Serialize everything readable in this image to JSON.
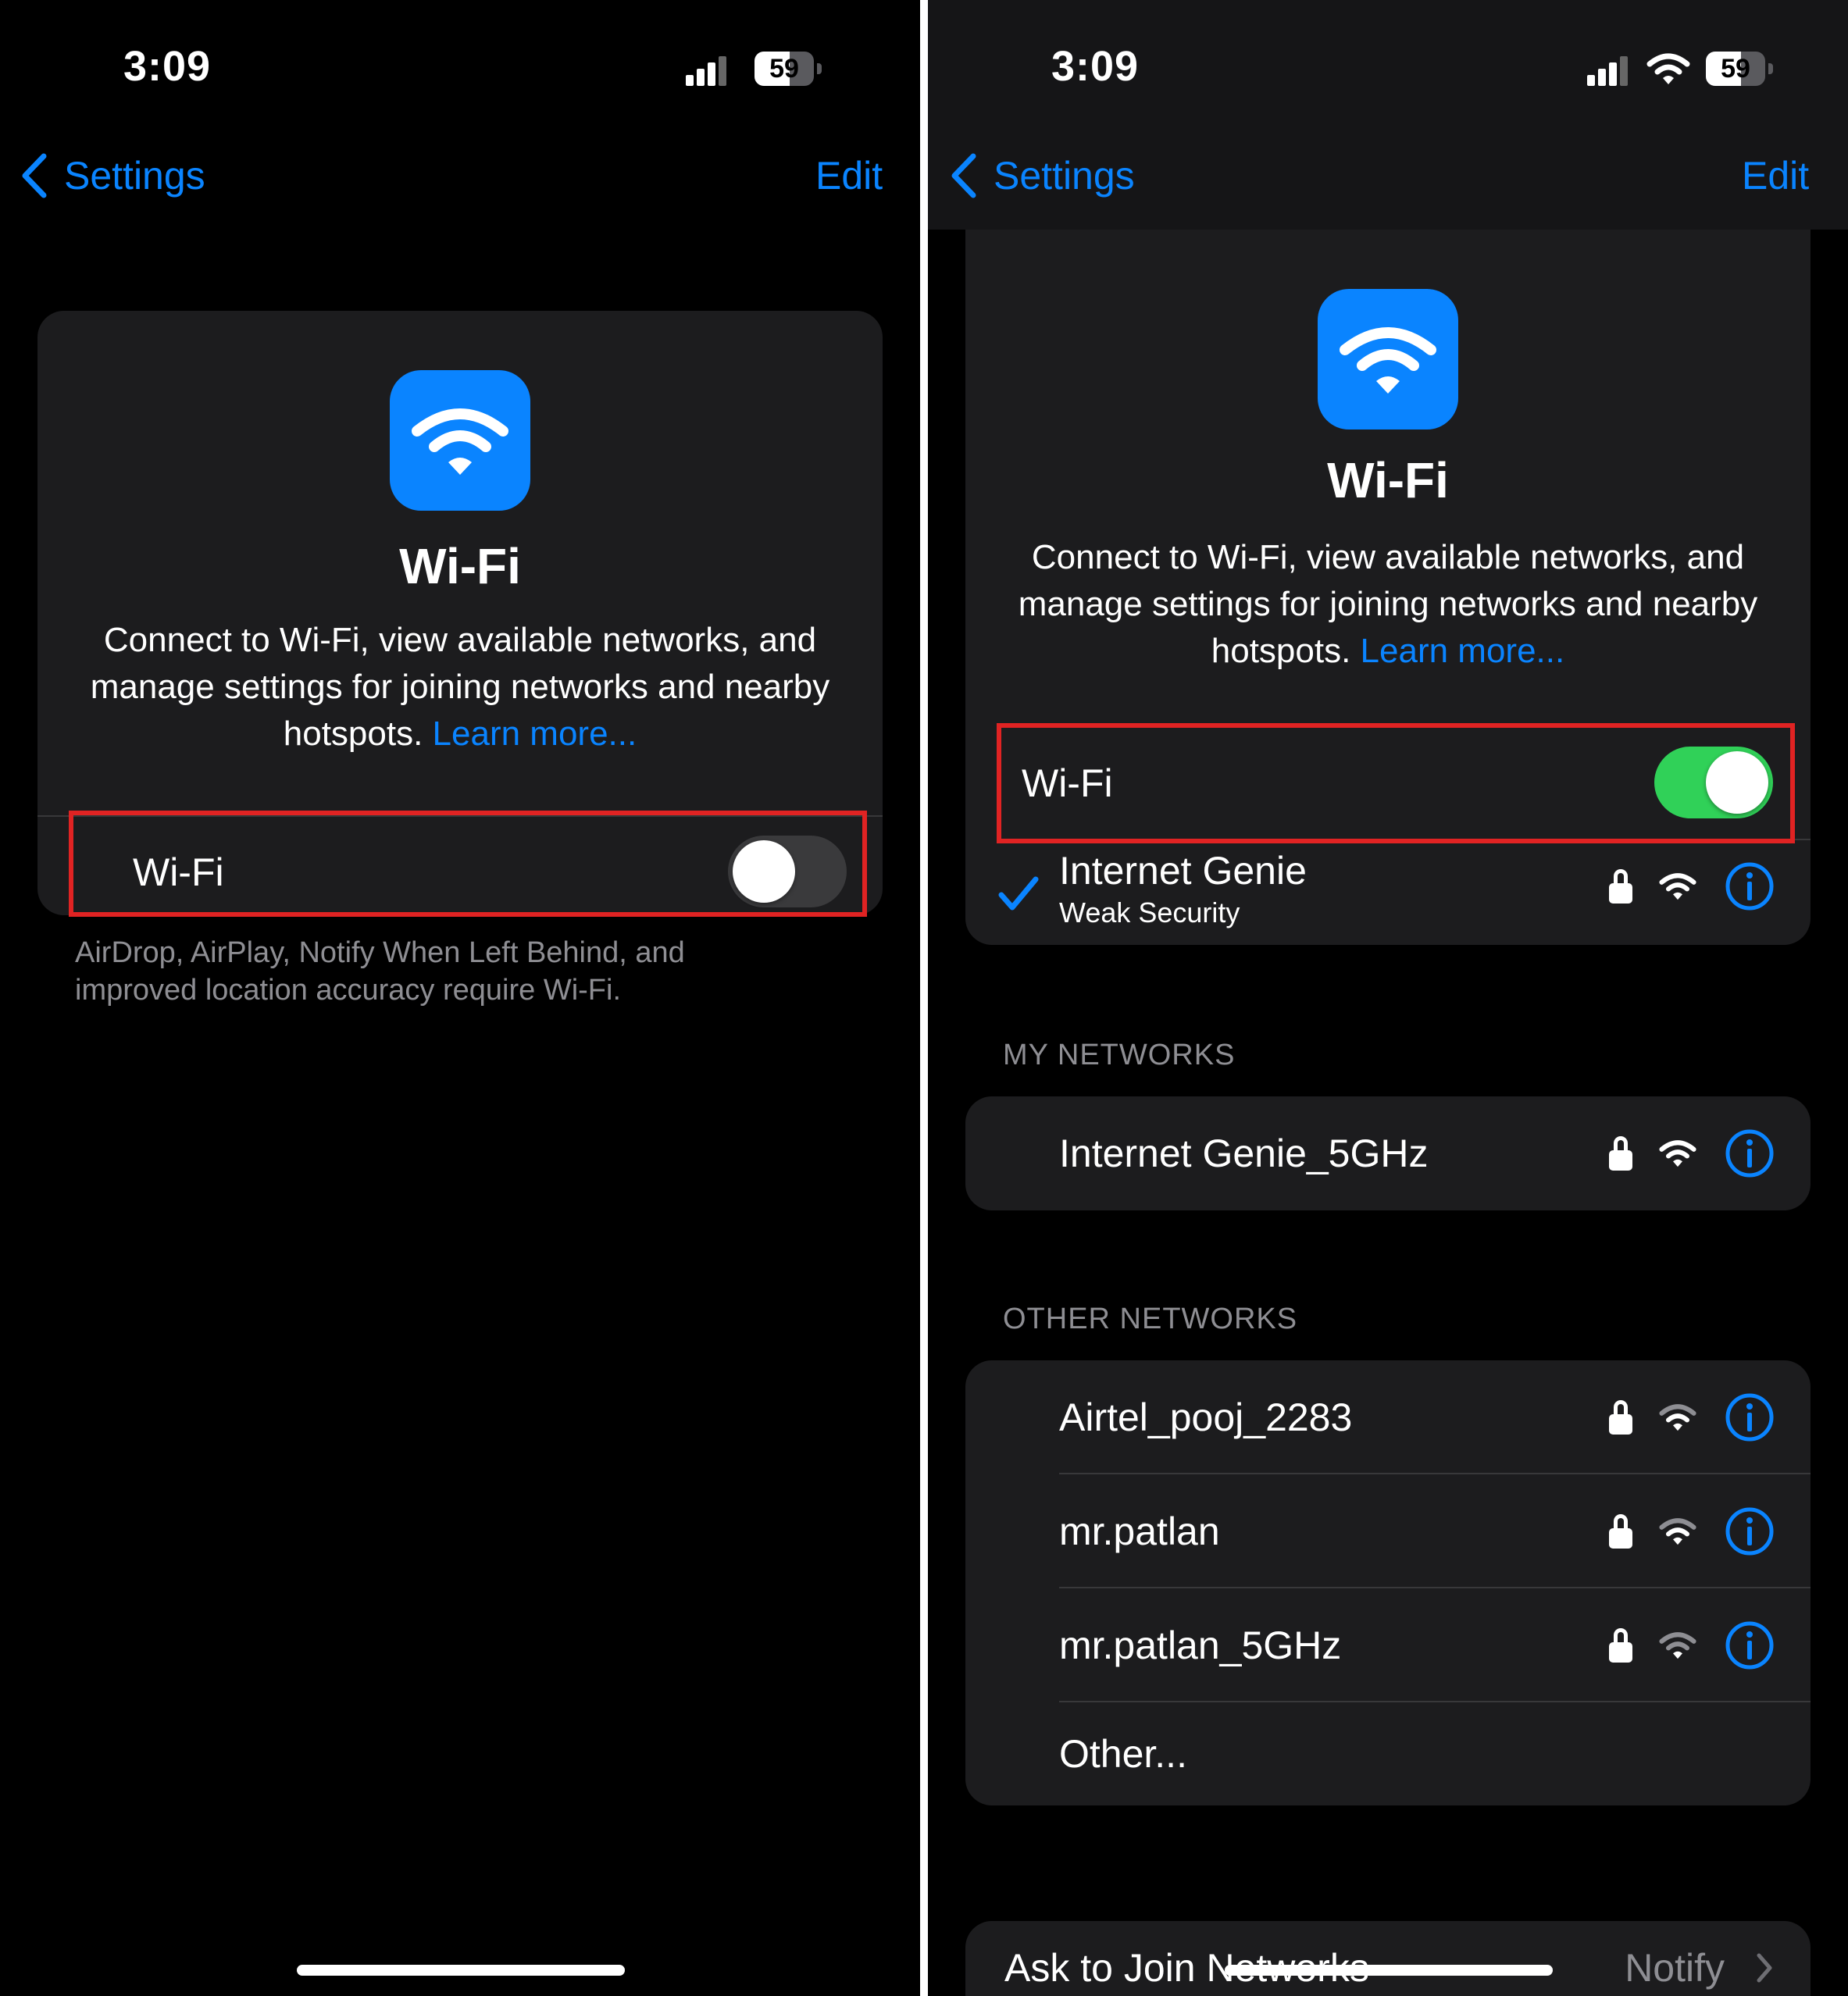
{
  "status_bar": {
    "time": "3:09",
    "battery": "59",
    "battery_level_percent": 59
  },
  "nav": {
    "back_label": "Settings",
    "edit_label": "Edit"
  },
  "hero": {
    "title": "Wi-Fi",
    "description": "Connect to Wi-Fi, view available networks, and manage settings for joining networks and nearby hotspots.",
    "learn_more": "Learn more..."
  },
  "left": {
    "wifi_label": "Wi-Fi",
    "wifi_on": false,
    "footnote_line1": "AirDrop, AirPlay, Notify When Left Behind, and",
    "footnote_line2": "improved location accuracy require Wi-Fi."
  },
  "right": {
    "wifi_label": "Wi-Fi",
    "wifi_on": true,
    "connected": {
      "name": "Internet Genie",
      "subtitle": "Weak Security"
    },
    "my_networks_header": "MY NETWORKS",
    "my_networks": [
      {
        "name": "Internet Genie_5GHz"
      }
    ],
    "other_networks_header": "OTHER NETWORKS",
    "other_networks": [
      {
        "name": "Airtel_pooj_2283"
      },
      {
        "name": "mr.patlan"
      },
      {
        "name": "mr.patlan_5GHz"
      }
    ],
    "other_label": "Other...",
    "ask_to_join": {
      "label": "Ask to Join Networks",
      "value": "Notify"
    }
  },
  "colors": {
    "accent": "#0a84ff",
    "toggle_on": "#30d158",
    "toggle_off": "#3a3a3c",
    "highlight": "#e02323",
    "card": "#1c1c1e"
  },
  "icons": [
    "chevron-left-icon",
    "wifi-icon",
    "lock-icon",
    "info-icon",
    "checkmark-icon",
    "chevron-right-icon",
    "cellular-signal-icon",
    "battery-icon"
  ]
}
